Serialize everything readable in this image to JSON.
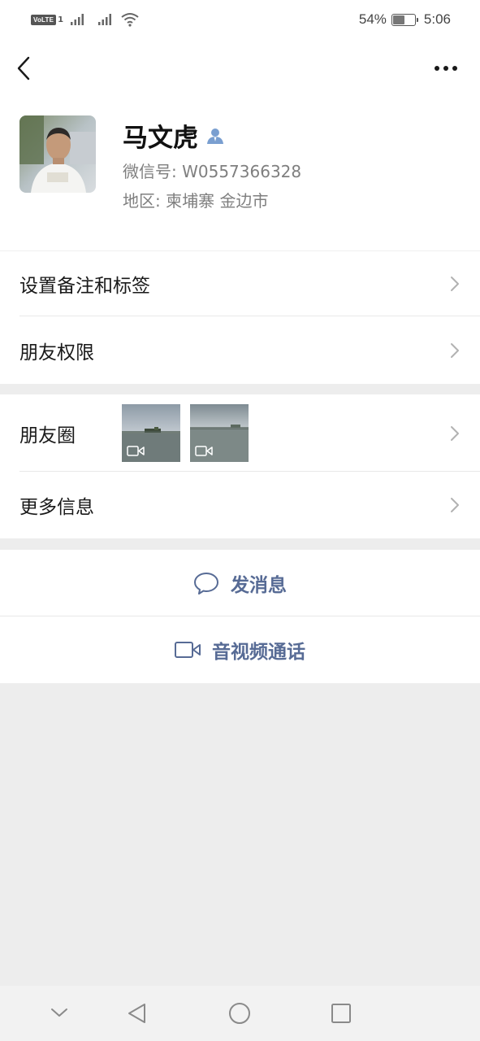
{
  "status_bar": {
    "network_badge": "VoLTE",
    "network_badge_sub": "1",
    "battery_percent": "54%",
    "battery_level": 0.54,
    "time": "5:06",
    "icons": [
      "volte-icon",
      "signal-icon",
      "signal-icon",
      "wifi-icon",
      "battery-icon"
    ]
  },
  "nav": {
    "back_icon": "chevron-left-icon",
    "more_icon": "more-dots-icon"
  },
  "profile": {
    "name": "马文虎",
    "verified_icon": "contact-person-icon",
    "wechat_id": "微信号: W0557366328",
    "region": "地区: 柬埔寨  金边市"
  },
  "cells": {
    "remark_label": "设置备注和标签",
    "permissions_label": "朋友权限",
    "moments_label": "朋友圈",
    "more_info_label": "更多信息"
  },
  "moments": {
    "thumbnails": [
      {
        "type": "video",
        "icon": "video-camera-icon"
      },
      {
        "type": "video",
        "icon": "video-camera-icon"
      }
    ]
  },
  "actions": {
    "message_label": "发消息",
    "message_icon": "chat-bubble-icon",
    "call_label": "音视频通话",
    "call_icon": "video-camera-icon"
  },
  "system_nav": [
    "chevron-down-icon",
    "back-triangle-icon",
    "home-circle-icon",
    "recents-square-icon"
  ],
  "colors": {
    "link_blue": "#576b95",
    "background": "#ededed",
    "secondary_text": "#7f7f7f"
  }
}
